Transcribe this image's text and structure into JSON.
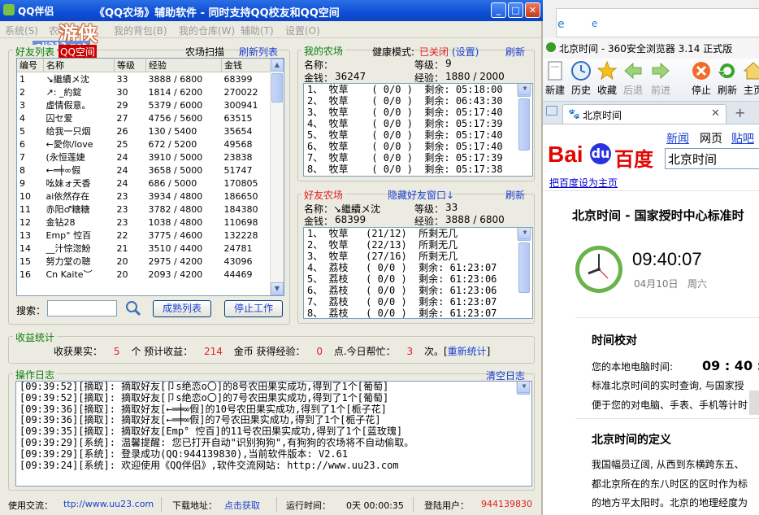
{
  "app": {
    "title": "《QQ农场》辅助软件  -  同时支持QQ校友和QQ空间",
    "title_prefix": "QQ伴侣",
    "menu": [
      "系统(S)",
      "农场(F)",
      "我的背包(B)",
      "我的仓库(W)",
      "辅助(T)",
      "设置(O)"
    ],
    "logo_text": "游侠",
    "logo_url": "ali213.net"
  },
  "friends": {
    "group_title": "好友列表",
    "tab_label": "QQ空间",
    "scan_label": "农场扫描",
    "refresh_label": "刷新列表",
    "columns": [
      "编号",
      "名称",
      "等级",
      "经验",
      "金钱"
    ],
    "rows": [
      [
        "1",
        "↘繼續メ沈",
        "33",
        "3888 / 6800",
        "68399"
      ],
      [
        "2",
        "↗:  _約錠",
        "30",
        "1814 / 6200",
        "270022"
      ],
      [
        "3",
        "虚情假意。",
        "29",
        "5379 / 6000",
        "300941"
      ],
      [
        "4",
        "囚セ爱",
        "27",
        "4756 / 5600",
        "63515"
      ],
      [
        "5",
        "给我一只烟",
        "26",
        "130 / 5400",
        "35654"
      ],
      [
        "6",
        "←愛你/love",
        "25",
        "672 / 5200",
        "49568"
      ],
      [
        "7",
        "(永恒莲婕",
        "24",
        "3910 / 5000",
        "23838"
      ],
      [
        "8",
        "←═╪∞假",
        "24",
        "3658 / 5000",
        "51747"
      ],
      [
        "9",
        "吆妹ォ天香",
        "24",
        "686 / 5000",
        "170805"
      ],
      [
        "10",
        "ai依然存在",
        "23",
        "3934 / 4800",
        "186650"
      ],
      [
        "11",
        "赤阳♂糖糖",
        "23",
        "3782 / 4800",
        "184380"
      ],
      [
        "12",
        "金钻28",
        "23",
        "1038 / 4800",
        "110698"
      ],
      [
        "13",
        "Emp°  悾百",
        "22",
        "3775 / 4600",
        "132228"
      ],
      [
        "14",
        "__汁悰淴魵",
        "21",
        "3510 / 4400",
        "24781"
      ],
      [
        "15",
        "努力堂の聰",
        "20",
        "2975 / 4200",
        "43096"
      ],
      [
        "16",
        "Cn Kaite︶",
        "20",
        "2093 / 4200",
        "44469"
      ]
    ],
    "search_label": "搜索：",
    "search_value": "",
    "mature_button": "成熟列表",
    "stop_button": "停止工作"
  },
  "my_farm": {
    "title": "我的农场",
    "health_label": "健康模式:",
    "health_value": "已关闭",
    "settings_link": "(设置)",
    "refresh_label": "刷新",
    "name_label": "名称：",
    "name_value": "",
    "level_label": "等级：",
    "level_value": "9",
    "money_label": "金钱：",
    "money_value": "36247",
    "exp_label": "经验：",
    "exp_value": "1880 / 2000",
    "plots": [
      "1、 牧草    ( 0/0 )  剩余: 05:18:00",
      "2、 牧草    ( 0/0 )  剩余: 06:43:30",
      "3、 牧草    ( 0/0 )  剩余: 05:17:40",
      "4、 牧草    ( 0/0 )  剩余: 05:17:39",
      "5、 牧草    ( 0/0 )  剩余: 05:17:40",
      "6、 牧草    ( 0/0 )  剩余: 05:17:40",
      "7、 牧草    ( 0/0 )  剩余: 05:17:39",
      "8、 牧草    ( 0/0 )  剩余: 05:17:38"
    ]
  },
  "friend_farm": {
    "title": "好友农场",
    "hide_link": "隐藏好友窗口↓",
    "refresh_label": "刷新",
    "name_label": "名称：",
    "name_value": "↘繼續メ沈",
    "level_label": "等级：",
    "level_value": "33",
    "money_label": "金钱：",
    "money_value": "68399",
    "exp_label": "经验：",
    "exp_value": "3888 / 6800",
    "plots": [
      "1、 牧草   (21/12)  所剩无几",
      "2、 牧草   (22/13)  所剩无几",
      "3、 牧草   (27/16)  所剩无几",
      "4、 荔枝   ( 0/0 )  剩余: 61:23:07",
      "5、 荔枝   ( 0/0 )  剩余: 61:23:06",
      "6、 荔枝   ( 0/0 )  剩余: 61:23:06",
      "7、 荔枝   ( 0/0 )  剩余: 61:23:07",
      "8、 荔枝   ( 0/0 )  剩余: 61:23:07"
    ]
  },
  "stats": {
    "title": "收益统计",
    "harvest_label": "收获果实：",
    "harvest_value": "5",
    "harvest_unit": "个 预计收益：",
    "income_value": "214",
    "exp_label": "金币 获得经验：",
    "exp_value": "0",
    "help_label": "点.今日帮忙：",
    "help_value": "3",
    "help_unit": "次。[",
    "restat_link": "重新统计",
    "close_bracket": "]"
  },
  "log": {
    "title": "操作日志",
    "clear_link": "清空日志",
    "lines": [
      "[09:39:52][摘取]: 摘取好友[卩s绝恋o〇]的8号农田果实成功,得到了1个[葡萄]",
      "[09:39:52][摘取]: 摘取好友[卩s绝恋o〇]的7号农田果实成功,得到了1个[葡萄]",
      "[09:39:36][摘取]: 摘取好友[←═╪∞假]的10号农田果实成功,得到了1个[栀子花]",
      "[09:39:36][摘取]: 摘取好友[←═╪∞假]的7号农田果实成功,得到了1个[栀子花]",
      "[09:39:35][摘取]: 摘取好友[Emp° 悾百]的11号农田果实成功,得到了1个[蓝玫瑰]",
      "[09:39:29][系统]: 温馨提醒: 您已打开自动\"识别狗狗\",有狗狗的农场将不自动偷取。",
      "[09:39:29][系统]: 登录成功(QQ:944139830),当前软件版本: V2.61",
      "[09:39:24][系统]: 欢迎使用《QQ伴侣》,软件交流网站: http://www.uu23.com"
    ]
  },
  "status": {
    "exchange_label": "使用交流：",
    "exchange_url": "ttp://www.uu23.com",
    "download_label": "下载地址：",
    "download_link": "点击获取",
    "runtime_label": "运行时间：",
    "runtime_value": "0天 00:00:35",
    "user_label": "登陆用户：",
    "user_value": "944139830"
  },
  "browser": {
    "top_tab": "北京时间 - 360安全浏览器 3.14 正式版",
    "toolbar": [
      "新建",
      "历史",
      "收藏",
      "后退",
      "前进",
      "停止",
      "刷新",
      "主页"
    ],
    "tab_title": "北京时间",
    "nav_links": [
      "新闻",
      "网页",
      "贴吧"
    ],
    "search_value": "北京时间",
    "set_home": "把百度设为主页",
    "headline": "北京时间 - 国家授时中心标准时",
    "clock_time": "09:40:07",
    "clock_date": "04月10日",
    "clock_weekday": "周六",
    "calib_title": "时间校对",
    "local_time_label": "您的本地电脑时间:",
    "local_time_value": "09 : 40 : 0",
    "calib_text1": "标准北京时间的实时查询, 与国家授",
    "calib_text2": "便于您的对电脑、手表、手机等计时",
    "def_title": "北京时间的定义",
    "def_text1": "我国幅员辽阔, 从西到东横跨东五、",
    "def_text2": "都北京所在的东八时区的区时作为标",
    "def_text3": "的地方平太阳时。北京的地理经度为"
  }
}
